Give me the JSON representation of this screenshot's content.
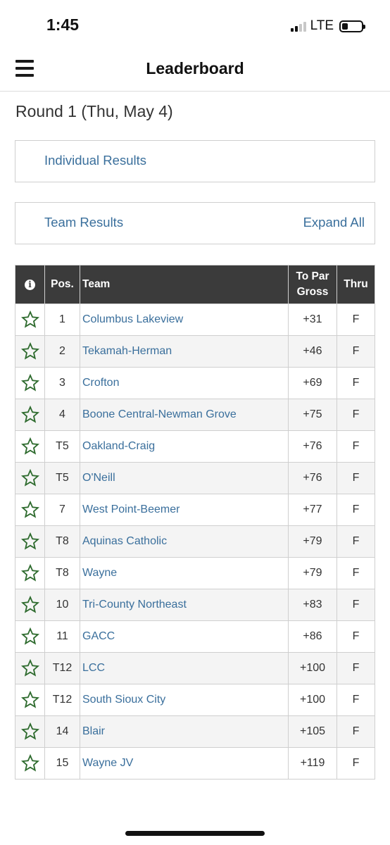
{
  "status_bar": {
    "time": "1:45",
    "network": "LTE"
  },
  "header": {
    "title": "Leaderboard"
  },
  "round_title": "Round 1 (Thu, May 4)",
  "individual_panel": {
    "label": "Individual Results"
  },
  "team_panel": {
    "label": "Team Results",
    "expand_label": "Expand All"
  },
  "table": {
    "headers": {
      "pos": "Pos.",
      "team": "Team",
      "to_par_line1": "To Par",
      "to_par_line2": "Gross",
      "thru": "Thru"
    },
    "rows": [
      {
        "pos": "1",
        "team": "Columbus Lakeview",
        "to_par": "+31",
        "thru": "F"
      },
      {
        "pos": "2",
        "team": "Tekamah-Herman",
        "to_par": "+46",
        "thru": "F"
      },
      {
        "pos": "3",
        "team": "Crofton",
        "to_par": "+69",
        "thru": "F"
      },
      {
        "pos": "4",
        "team": "Boone Central-Newman Grove",
        "to_par": "+75",
        "thru": "F"
      },
      {
        "pos": "T5",
        "team": "Oakland-Craig",
        "to_par": "+76",
        "thru": "F"
      },
      {
        "pos": "T5",
        "team": "O'Neill",
        "to_par": "+76",
        "thru": "F"
      },
      {
        "pos": "7",
        "team": "West Point-Beemer",
        "to_par": "+77",
        "thru": "F"
      },
      {
        "pos": "T8",
        "team": "Aquinas Catholic",
        "to_par": "+79",
        "thru": "F"
      },
      {
        "pos": "T8",
        "team": "Wayne",
        "to_par": "+79",
        "thru": "F"
      },
      {
        "pos": "10",
        "team": "Tri-County Northeast",
        "to_par": "+83",
        "thru": "F"
      },
      {
        "pos": "11",
        "team": "GACC",
        "to_par": "+86",
        "thru": "F"
      },
      {
        "pos": "T12",
        "team": "LCC",
        "to_par": "+100",
        "thru": "F"
      },
      {
        "pos": "T12",
        "team": "South Sioux City",
        "to_par": "+100",
        "thru": "F"
      },
      {
        "pos": "14",
        "team": "Blair",
        "to_par": "+105",
        "thru": "F"
      },
      {
        "pos": "15",
        "team": "Wayne JV",
        "to_par": "+119",
        "thru": "F"
      }
    ]
  },
  "colors": {
    "link": "#3a6f9c",
    "header_bg": "#3b3b3b",
    "star": "#2e6b2e"
  },
  "icons": {
    "menu": "hamburger-menu-icon",
    "info": "info-icon",
    "favorite": "star-outline-icon"
  }
}
